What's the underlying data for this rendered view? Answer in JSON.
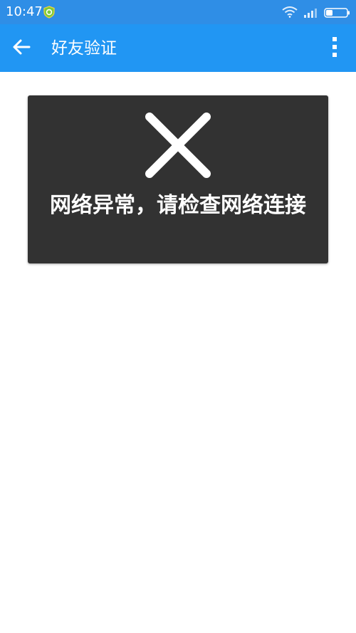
{
  "status_bar": {
    "time": "10:47",
    "app_icon": "shield-app-icon",
    "wifi_icon": "wifi-icon",
    "signal_icon": "signal-icon",
    "battery_icon": "battery-icon",
    "color": "#2f8ee6"
  },
  "app_bar": {
    "title": "好友验证",
    "back_icon": "arrow-left-icon",
    "more_icon": "more-vertical-icon",
    "color": "#2196f3"
  },
  "toast": {
    "icon": "close-icon",
    "message": "网络异常，请检查网络连接",
    "background": "#323232"
  }
}
